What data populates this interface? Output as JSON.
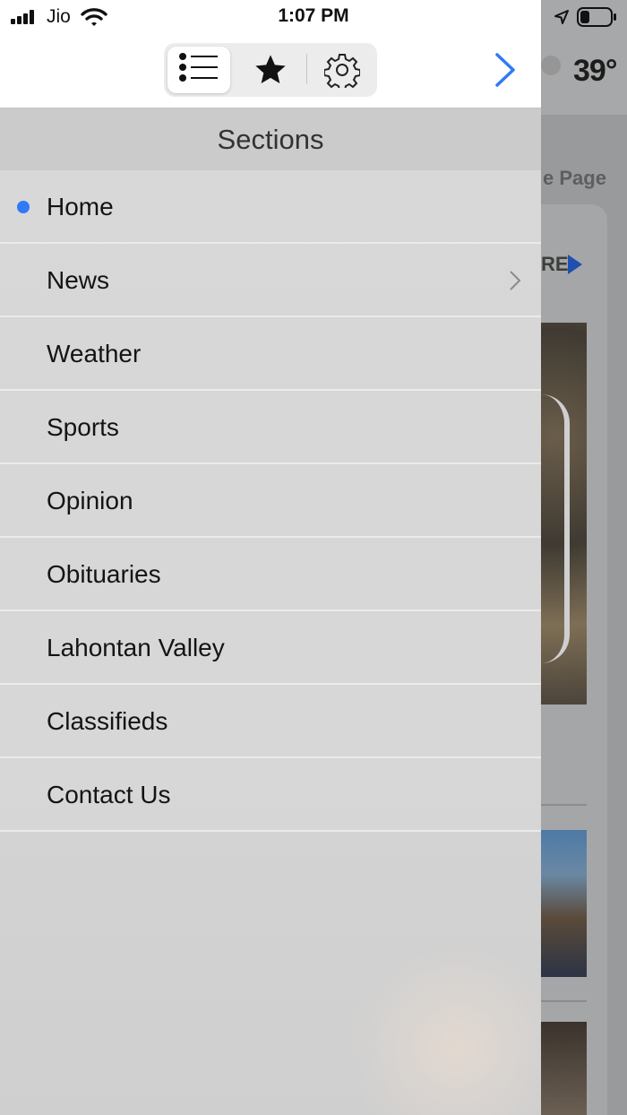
{
  "status_bar": {
    "carrier": "Jio",
    "time": "1:07 PM"
  },
  "toolbar": {
    "sections_icon": "list-icon",
    "favorites_icon": "star-icon",
    "settings_icon": "gear-icon",
    "forward_icon": "chevron-right-icon"
  },
  "background_page": {
    "temperature": "39°",
    "tab_label": "e Page",
    "more_label": "RE"
  },
  "drawer": {
    "title": "Sections",
    "items": [
      {
        "label": "Home",
        "selected": true
      },
      {
        "label": "News",
        "has_submenu": true
      },
      {
        "label": "Weather"
      },
      {
        "label": "Sports"
      },
      {
        "label": "Opinion"
      },
      {
        "label": "Obituaries"
      },
      {
        "label": "Lahontan Valley"
      },
      {
        "label": "Classifieds"
      },
      {
        "label": "Contact Us"
      }
    ]
  },
  "colors": {
    "accent_blue": "#2f7af6",
    "chevron_blue": "#2f7af6"
  }
}
